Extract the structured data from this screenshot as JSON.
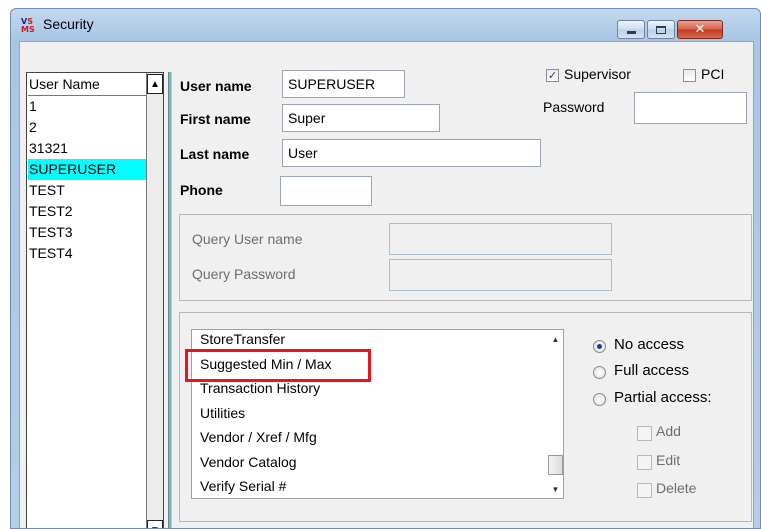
{
  "window": {
    "title": "Security"
  },
  "user_list": {
    "header": "User Name",
    "items": [
      "1",
      "2",
      "31321",
      "SUPERUSER",
      "TEST",
      "TEST2",
      "TEST3",
      "TEST4"
    ],
    "selected": "SUPERUSER"
  },
  "form": {
    "username_label": "User name",
    "username_value": "SUPERUSER",
    "firstname_label": "First name",
    "firstname_value": "Super",
    "lastname_label": "Last name",
    "lastname_value": "User",
    "phone_label": "Phone",
    "phone_value": "",
    "supervisor_label": "Supervisor",
    "supervisor_checked": true,
    "pci_label": "PCI",
    "pci_checked": false,
    "password_label": "Password",
    "password_value": ""
  },
  "query": {
    "username_label": "Query User name",
    "password_label": "Query Password"
  },
  "permissions": {
    "items": [
      "StoreTransfer",
      "Suggested Min / Max",
      "Transaction History",
      "Utilities",
      "Vendor / Xref / Mfg",
      "Vendor Catalog",
      "Verify Serial #"
    ],
    "highlighted": "Suggested Min / Max"
  },
  "access": {
    "no_access": "No access",
    "full_access": "Full access",
    "partial_access": "Partial access:",
    "selected": "No access",
    "add": "Add",
    "edit": "Edit",
    "delete": "Delete"
  },
  "colors": {
    "selection": "#00ffff",
    "highlight": "#e8151a"
  }
}
